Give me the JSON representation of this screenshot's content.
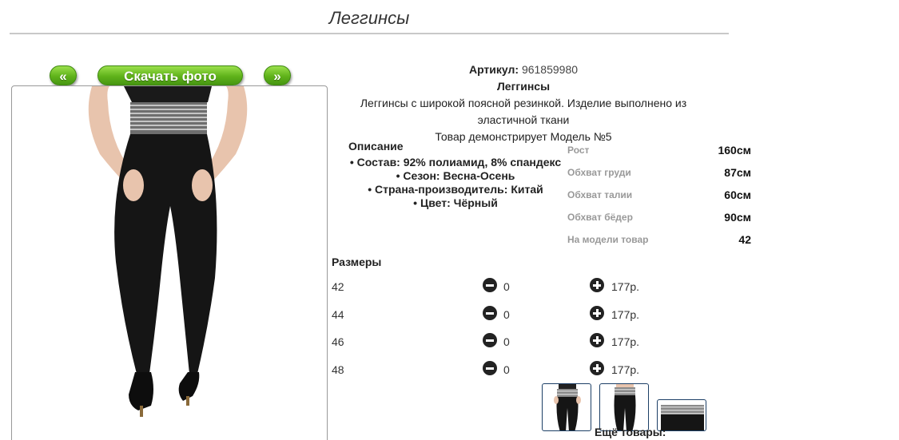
{
  "page": {
    "title": "Леггинсы"
  },
  "gallery": {
    "prev_label": "«",
    "download_label": "Скачать фото",
    "next_label": "»"
  },
  "product": {
    "article_label": "Артикул:",
    "article_value": "961859980",
    "name": "Леггинсы",
    "summary": "Леггинсы с широкой поясной резинкой. Изделие выполнено из эластичной ткани",
    "model_note": "Товар демонстрирует Модель №5"
  },
  "description": {
    "heading": "Описание",
    "items": [
      "Состав: 92% полиамид, 8% спандекс",
      "Сезон: Весна-Осень",
      "Страна-производитель: Китай",
      "Цвет: Чёрный"
    ]
  },
  "model_params": [
    {
      "label": "Рост",
      "value": "160см"
    },
    {
      "label": "Обхват груди",
      "value": "87см"
    },
    {
      "label": "Обхват талии",
      "value": "60см"
    },
    {
      "label": "Обхват бёдер",
      "value": "90см"
    },
    {
      "label": "На модели товар",
      "value": "42"
    }
  ],
  "sizes": {
    "heading": "Размеры",
    "rows": [
      {
        "size": "42",
        "qty": "0",
        "price": "177р."
      },
      {
        "size": "44",
        "qty": "0",
        "price": "177р."
      },
      {
        "size": "46",
        "qty": "0",
        "price": "177р."
      },
      {
        "size": "48",
        "qty": "0",
        "price": "177р."
      }
    ]
  },
  "more_label": "Ещё товары:",
  "icons": {
    "decrease": "minus-circle-icon",
    "increase": "plus-circle-icon"
  },
  "colors": {
    "button_green": "#5fb21a",
    "thumb_border": "#1c3f66"
  }
}
